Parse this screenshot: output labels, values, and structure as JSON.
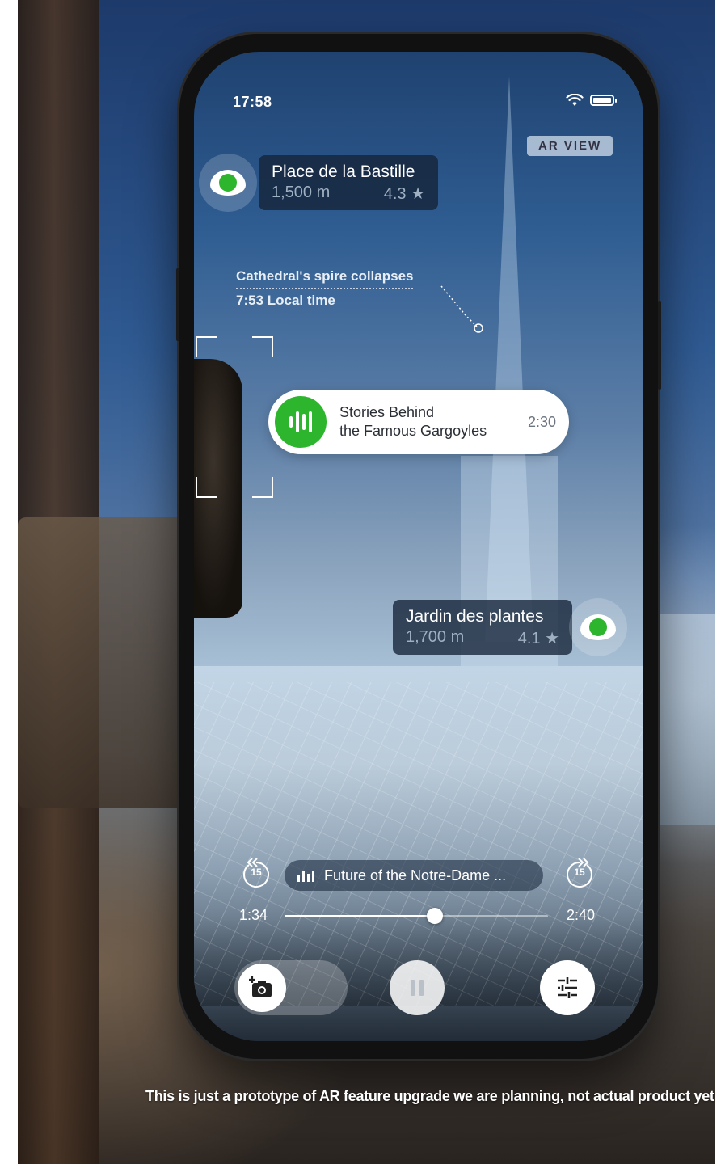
{
  "status_bar": {
    "time": "17:58"
  },
  "ar_badge": "AR VIEW",
  "poi_top": {
    "name": "Place de la Bastille",
    "distance": "1,500 m",
    "rating": "4.3 ★"
  },
  "event_annotation": {
    "title": "Cathedral's spire collapses",
    "time": "7:53 Local time"
  },
  "story_card": {
    "line1": "Stories Behind",
    "line2": "the Famous Gargoyles",
    "duration": "2:30"
  },
  "poi_bottom": {
    "name": "Jardin des plantes",
    "distance": "1,700 m",
    "rating": "4.1 ★"
  },
  "player": {
    "now_playing": "Future of the Notre-Dame ...",
    "current_time": "1:34",
    "total_time": "2:40",
    "progress": 0.57,
    "skip_back_seconds": "15",
    "skip_forward_seconds": "15"
  },
  "disclaimer": "This is just a prototype of AR feature upgrade we are planning, not actual product yet",
  "colors": {
    "accent_green": "#2db52d"
  }
}
